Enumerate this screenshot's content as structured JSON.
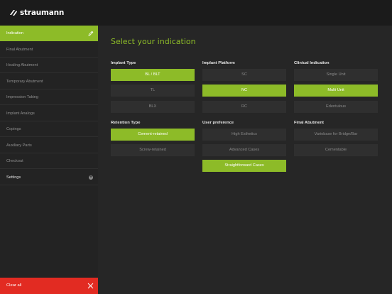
{
  "brand": {
    "name": "straumann"
  },
  "colors": {
    "accent": "#8dbb28",
    "danger": "#e22b22",
    "background": "#262626",
    "sidebar": "#232323",
    "topbar": "#1b1b1b"
  },
  "sidebar": {
    "items": [
      {
        "label": "Indication",
        "active": true,
        "icon": "pencil-icon"
      },
      {
        "label": "Final Abutment"
      },
      {
        "label": "Healing Abutment"
      },
      {
        "label": "Temporary Abutment"
      },
      {
        "label": "Impression Taking"
      },
      {
        "label": "Implant Analogs"
      },
      {
        "label": "Copings"
      },
      {
        "label": "Auxiliary Parts"
      },
      {
        "label": "Checkout"
      },
      {
        "label": "Settings",
        "icon": "plus-icon"
      }
    ],
    "clear_all": "Clear all"
  },
  "main": {
    "title": "Select your indication",
    "groups": {
      "implant_type": {
        "label": "Implant Type",
        "options": [
          "BL / BLT",
          "TL",
          "BLX"
        ],
        "selected": "BL / BLT"
      },
      "implant_platform": {
        "label": "Implant Platform",
        "options": [
          "SC",
          "NC",
          "RC"
        ],
        "selected": "NC"
      },
      "clinical_indication": {
        "label": "Clinical Indication",
        "options": [
          "Single Unit",
          "Multi Unit",
          "Edentulous"
        ],
        "selected": "Multi Unit"
      },
      "retention_type": {
        "label": "Retention Type",
        "options": [
          "Cement-retained",
          "Screw-retained"
        ],
        "selected": "Cement-retained"
      },
      "user_preference": {
        "label": "User preference",
        "options": [
          "High Esthetics",
          "Advanced Cases",
          "Straightforward Cases"
        ],
        "selected": "Straightforward Cases"
      },
      "final_abutment": {
        "label": "Final Abutment",
        "options": [
          "Variobase for Bridge/Bar",
          "Cementable"
        ],
        "selected": null
      }
    }
  }
}
